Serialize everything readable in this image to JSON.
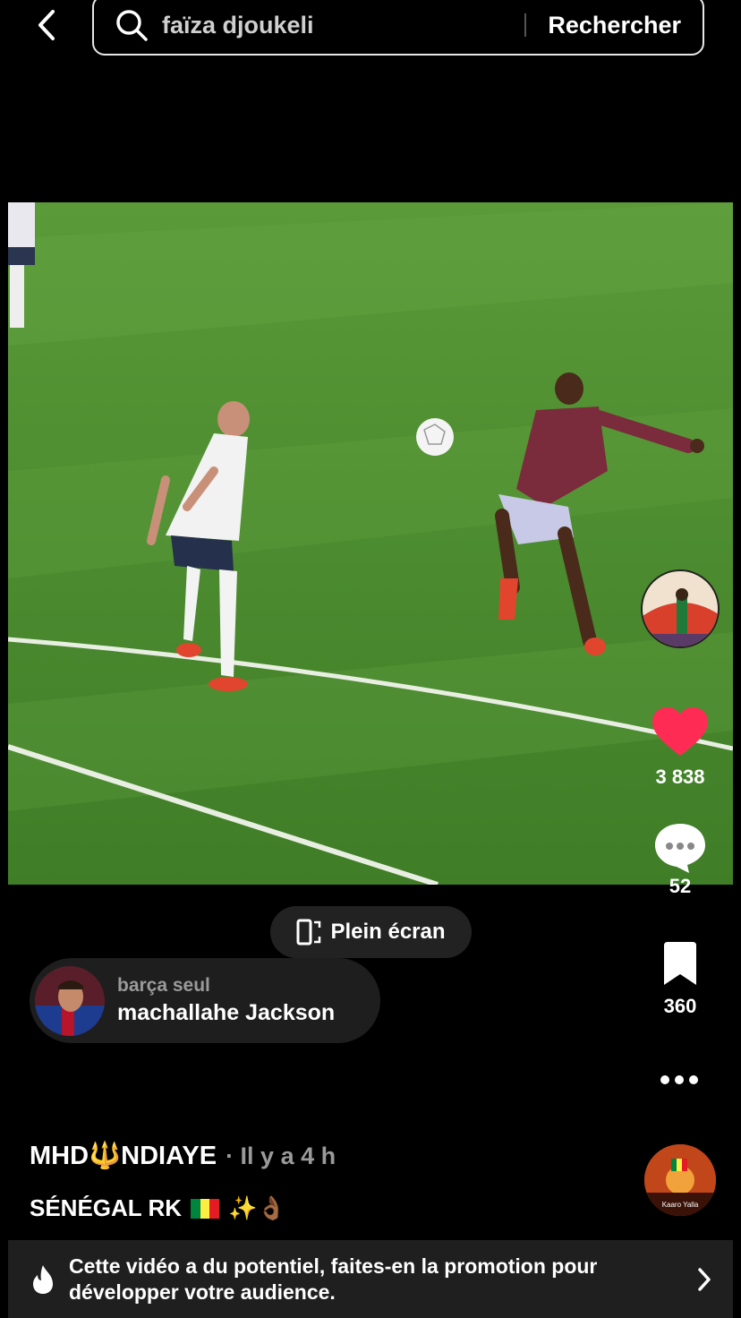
{
  "search": {
    "query": "faïza djoukeli",
    "submit_label": "Rechercher"
  },
  "actions": {
    "likes": "3 838",
    "comments": "52",
    "saves": "360"
  },
  "fullscreen_label": "Plein écran",
  "top_comment": {
    "author": "barça seul",
    "text": "machallahe Jackson"
  },
  "post": {
    "author": "MHD🔱NDIAYE",
    "time": "· Il y a 4 h",
    "caption": "SÉNÉGAL RK",
    "caption_emojis": "✨👌🏾"
  },
  "sound_avatar_label": "Kaaro Yalla",
  "promo": {
    "text": "Cette vidéo a du potentiel, faites-en la promotion pour développer votre audience."
  },
  "colors": {
    "like": "#fe2c55",
    "pitch": "#4d8a2e"
  }
}
